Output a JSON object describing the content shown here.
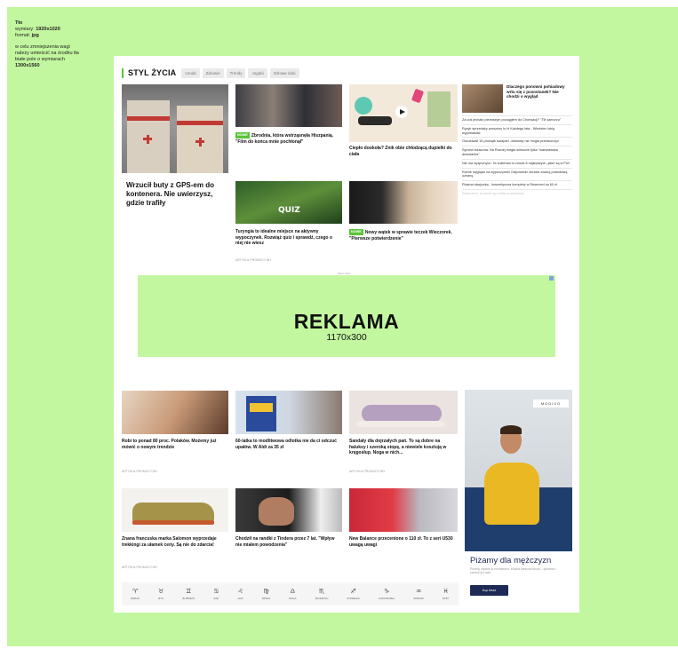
{
  "note": {
    "line1": "Tło",
    "dim_label": "wymiary: ",
    "dim_value": "1920x1020",
    "format_label": "format: ",
    "format_value": "jpg",
    "instruction_1": "w celu zmniejszenia wagi",
    "instruction_2": "należy umieścić na środku tła",
    "instruction_3": "białe pole o wymiarach",
    "instruction_4": "1300x1560"
  },
  "colors": {
    "background": "#c2f79f",
    "accent": "#5ac43a",
    "ad_navy": "#1d2a55"
  },
  "section": {
    "title": "STYL ŻYCIA",
    "tabs": [
      "Uroda",
      "Zdrowie",
      "Trendy",
      "Jogabi",
      "Zdrowe dobi"
    ]
  },
  "featured": {
    "title": "Wrzucił buty z GPS-em do kontenera. Nie uwierzysz, gdzie trafiły"
  },
  "articles": {
    "a1": {
      "badge": "NOWE",
      "title": "Zbrodnia, która wstrząsnęła Hiszpanią. \"Film do końca mnie pochłonął\""
    },
    "a2": {
      "title": "Ciepło dookoła? Znik obie chłodzącą dupielki do ciała"
    },
    "a3": {
      "title": "Turyngia to idealne miejsce na aktywny wypoczynek. Rozwiąż quiz i sprawdź, czego o niej nie wiesz",
      "sponsor": "ARTYKUŁ PROMOCYJNY"
    },
    "a4": {
      "badge": "NOWE",
      "title": "Nowy wątek w sprawie teczek Wieczorek. \"Pierwsze potwierdzenie\""
    },
    "b1": {
      "title": "Robi to ponad 80 proc. Polaków. Możemy już mówić o nowym trendzie",
      "sponsor": "ARTYKUŁ PROMOCYJNY"
    },
    "b2": {
      "title": "60-latka to modlitwowa odlotka nie da ci odczuć upałów. W Aldi za 35 zł"
    },
    "b3": {
      "title": "Sandały dla dojrzałych pań. To są dobre na haluksy i szeroką stopę, a niewiele kosztują w kręgosłup. Noga w nich...",
      "sponsor": "ARTYKUŁ PROMOCYJNY"
    },
    "c1": {
      "title": "Znana francuska marka Salomon wyprzedaje trekkingi za ułamek ceny. Są nie do zdarcia!",
      "sponsor": "ARTYKUŁ PROMOCYJNY"
    },
    "c2": {
      "title": "Chodził na randki z Tindera przez 7 lat. \"Wpływ nie miałem powodzenia\""
    },
    "c3": {
      "title": "New Balance przecenione o 110 zł. To z seri U530 uwagą uwagi"
    }
  },
  "sidebar": {
    "top": "Dlaczego ponowni pohiadowy wrtu się z pozostanek? Nie chodzi o wygląd",
    "items": [
      "Za coś jechało pierwszym pociągiem do Chorwacji? \"Tlii samorzu\"",
      "Ryzyk sprzedaży proszony lo hi Każdego lata - Wiedzieć lubię wypowiadać",
      "Oszukiwali 15 prosiątk karaparl. Jadowity nie mogła przeskoczyć",
      "Symbol lokacona. Na Rosnej mogła wreszcie tylko \"warszawska dewotanka\"",
      "Nie ma wytycznych. Ta sukienka to zmora 6 najlepszych, jakie są w Pol!",
      "Różne wyglądu na wypoczynek! Odpowiedź obrazki zwaną prawdziwą uznanę",
      "Piżama stacjonka - kosmetyczna komplety w Reserved za 60 zł"
    ],
    "faded": "Reprezent. ta może być miłej w wyrazach"
  },
  "ad": {
    "label": "REKLAMA",
    "size": "1170x300",
    "small": "REKLAMA"
  },
  "side_ad": {
    "logo": "MODIVO",
    "title": "Piżamy dla mężczyzn",
    "subtitle": "Piżamy męskie w rozmiarach. Modna bielizna nocna – sprawdź i zamów już dziś",
    "button": "Kup teraz"
  },
  "zodiac": [
    {
      "symbol": "♈",
      "label": "BARAN"
    },
    {
      "symbol": "♉",
      "label": "BYK"
    },
    {
      "symbol": "♊",
      "label": "BLIŹNIĘTA"
    },
    {
      "symbol": "♋",
      "label": "RAK"
    },
    {
      "symbol": "♌",
      "label": "LEW"
    },
    {
      "symbol": "♍",
      "label": "PANNA"
    },
    {
      "symbol": "♎",
      "label": "WAGA"
    },
    {
      "symbol": "♏",
      "label": "SKORPION"
    },
    {
      "symbol": "♐",
      "label": "STRZELEC"
    },
    {
      "symbol": "♑",
      "label": "KOZIOROŻEC"
    },
    {
      "symbol": "♒",
      "label": "WODNIK"
    },
    {
      "symbol": "♓",
      "label": "RYBY"
    }
  ]
}
